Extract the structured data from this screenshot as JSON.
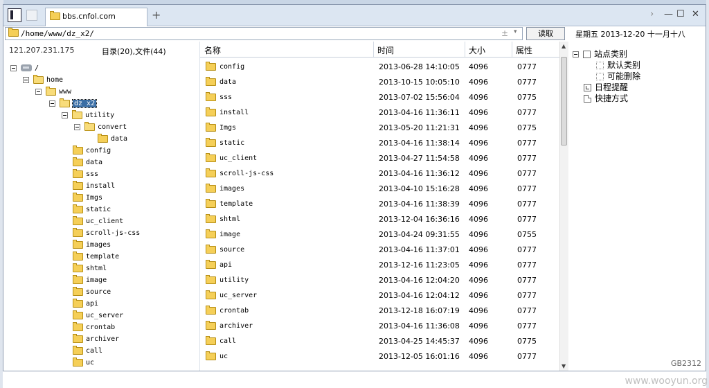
{
  "tab": {
    "title": "bbs.cnfol.com",
    "new_tab": "+"
  },
  "window_controls": {
    "nav": "›",
    "min": "—",
    "max": "☐",
    "close": "✕"
  },
  "address": {
    "path": "/home/www/dz_x2/",
    "pm": "±",
    "arrow": "▾"
  },
  "read_button": "读取",
  "date_text": "星期五  2013-12-20  十一月十八",
  "left": {
    "host": "121.207.231.175",
    "count": "目录(20),文件(44)",
    "tree": [
      {
        "label": "/",
        "depth": 0,
        "exp": true,
        "icon": "drive"
      },
      {
        "label": "home",
        "depth": 1,
        "exp": true,
        "icon": "folder"
      },
      {
        "label": "www",
        "depth": 2,
        "exp": true,
        "icon": "folder"
      },
      {
        "label": "dz_x2",
        "depth": 3,
        "exp": true,
        "icon": "folder",
        "selected": true
      },
      {
        "label": "utility",
        "depth": 4,
        "exp": true,
        "icon": "folder"
      },
      {
        "label": "convert",
        "depth": 5,
        "exp": true,
        "icon": "folder"
      },
      {
        "label": "data",
        "depth": 6,
        "exp": false,
        "icon": "folder"
      },
      {
        "label": "config",
        "depth": 4,
        "exp": false,
        "icon": "folder"
      },
      {
        "label": "data",
        "depth": 4,
        "exp": false,
        "icon": "folder"
      },
      {
        "label": "sss",
        "depth": 4,
        "exp": false,
        "icon": "folder"
      },
      {
        "label": "install",
        "depth": 4,
        "exp": false,
        "icon": "folder"
      },
      {
        "label": "Imgs",
        "depth": 4,
        "exp": false,
        "icon": "folder"
      },
      {
        "label": "static",
        "depth": 4,
        "exp": false,
        "icon": "folder"
      },
      {
        "label": "uc_client",
        "depth": 4,
        "exp": false,
        "icon": "folder"
      },
      {
        "label": "scroll-js-css",
        "depth": 4,
        "exp": false,
        "icon": "folder"
      },
      {
        "label": "images",
        "depth": 4,
        "exp": false,
        "icon": "folder"
      },
      {
        "label": "template",
        "depth": 4,
        "exp": false,
        "icon": "folder"
      },
      {
        "label": "shtml",
        "depth": 4,
        "exp": false,
        "icon": "folder"
      },
      {
        "label": "image",
        "depth": 4,
        "exp": false,
        "icon": "folder"
      },
      {
        "label": "source",
        "depth": 4,
        "exp": false,
        "icon": "folder"
      },
      {
        "label": "api",
        "depth": 4,
        "exp": false,
        "icon": "folder"
      },
      {
        "label": "uc_server",
        "depth": 4,
        "exp": false,
        "icon": "folder"
      },
      {
        "label": "crontab",
        "depth": 4,
        "exp": false,
        "icon": "folder"
      },
      {
        "label": "archiver",
        "depth": 4,
        "exp": false,
        "icon": "folder"
      },
      {
        "label": "call",
        "depth": 4,
        "exp": false,
        "icon": "folder"
      },
      {
        "label": "uc",
        "depth": 4,
        "exp": false,
        "icon": "folder"
      }
    ]
  },
  "columns": {
    "name": "名称",
    "time": "时间",
    "size": "大小",
    "attr": "属性"
  },
  "files": [
    {
      "name": "config",
      "time": "2013-06-28 14:10:05",
      "size": "4096",
      "attr": "0777"
    },
    {
      "name": "data",
      "time": "2013-10-15 10:05:10",
      "size": "4096",
      "attr": "0777"
    },
    {
      "name": "sss",
      "time": "2013-07-02 15:56:04",
      "size": "4096",
      "attr": "0775"
    },
    {
      "name": "install",
      "time": "2013-04-16 11:36:11",
      "size": "4096",
      "attr": "0777"
    },
    {
      "name": "Imgs",
      "time": "2013-05-20 11:21:31",
      "size": "4096",
      "attr": "0775"
    },
    {
      "name": "static",
      "time": "2013-04-16 11:38:14",
      "size": "4096",
      "attr": "0777"
    },
    {
      "name": "uc_client",
      "time": "2013-04-27 11:54:58",
      "size": "4096",
      "attr": "0777"
    },
    {
      "name": "scroll-js-css",
      "time": "2013-04-16 11:36:12",
      "size": "4096",
      "attr": "0777"
    },
    {
      "name": "images",
      "time": "2013-04-10 15:16:28",
      "size": "4096",
      "attr": "0777"
    },
    {
      "name": "template",
      "time": "2013-04-16 11:38:39",
      "size": "4096",
      "attr": "0777"
    },
    {
      "name": "shtml",
      "time": "2013-12-04 16:36:16",
      "size": "4096",
      "attr": "0777"
    },
    {
      "name": "image",
      "time": "2013-04-24 09:31:55",
      "size": "4096",
      "attr": "0755"
    },
    {
      "name": "source",
      "time": "2013-04-16 11:37:01",
      "size": "4096",
      "attr": "0777"
    },
    {
      "name": "api",
      "time": "2013-12-16 11:23:05",
      "size": "4096",
      "attr": "0777"
    },
    {
      "name": "utility",
      "time": "2013-04-16 12:04:20",
      "size": "4096",
      "attr": "0777"
    },
    {
      "name": "uc_server",
      "time": "2013-04-16 12:04:12",
      "size": "4096",
      "attr": "0777"
    },
    {
      "name": "crontab",
      "time": "2013-12-18 16:07:19",
      "size": "4096",
      "attr": "0777"
    },
    {
      "name": "archiver",
      "time": "2013-04-16 11:36:08",
      "size": "4096",
      "attr": "0777"
    },
    {
      "name": "call",
      "time": "2013-04-25 14:45:37",
      "size": "4096",
      "attr": "0775"
    },
    {
      "name": "uc",
      "time": "2013-12-05 16:01:16",
      "size": "4096",
      "attr": "0777"
    }
  ],
  "right": {
    "items": [
      {
        "label": "站点类别",
        "kind": "group"
      },
      {
        "label": "默认类别",
        "kind": "sub"
      },
      {
        "label": "可能删除",
        "kind": "sub"
      },
      {
        "label": "日程提醒",
        "kind": "clock"
      },
      {
        "label": "快捷方式",
        "kind": "page"
      }
    ]
  },
  "encoding": "GB2312",
  "watermark": "www.wooyun.org"
}
